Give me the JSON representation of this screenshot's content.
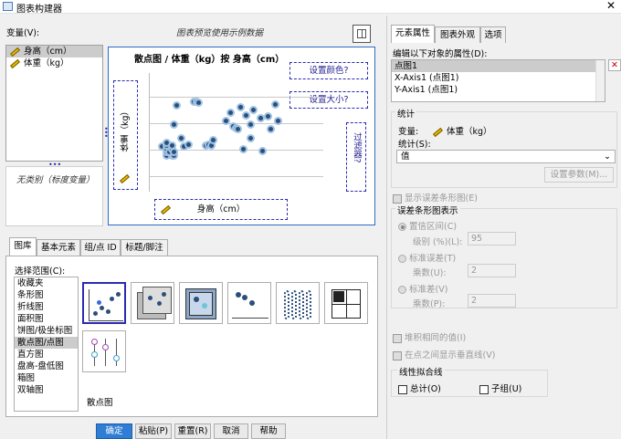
{
  "window": {
    "title": "图表构建器",
    "close_glyph": "✕"
  },
  "variables": {
    "label": "变量(V):",
    "items": [
      "身高（cm）",
      "体重（kg）"
    ],
    "no_category": "无类别（标度变量）"
  },
  "preview": {
    "notice": "图表预览使用示例数据",
    "chart_title": "散点图 / 体重（kg）按 身高（cm）",
    "set_color": "设置颜色?",
    "set_size": "设置大小?",
    "filter": "过滤器?",
    "y_label": "体重（kg）",
    "x_label": "身高（cm）"
  },
  "chart_data": {
    "type": "scatter",
    "title": "散点图 / 体重（kg）按 身高（cm）",
    "xlabel": "身高（cm）",
    "ylabel": "体重（kg）",
    "grid": true,
    "points": [
      [
        1,
        38
      ],
      [
        3,
        30
      ],
      [
        3,
        33
      ],
      [
        3,
        36
      ],
      [
        3,
        39
      ],
      [
        3,
        42
      ],
      [
        5,
        30
      ],
      [
        4,
        33
      ],
      [
        5,
        36
      ],
      [
        5,
        39
      ],
      [
        6,
        30
      ],
      [
        6,
        33
      ],
      [
        6,
        58
      ],
      [
        7,
        76
      ],
      [
        9,
        46
      ],
      [
        10,
        38
      ],
      [
        12,
        40
      ],
      [
        14,
        79
      ],
      [
        15,
        79
      ],
      [
        16,
        78
      ],
      [
        19,
        39
      ],
      [
        20,
        40
      ],
      [
        21,
        39
      ],
      [
        22,
        44
      ],
      [
        27,
        62
      ],
      [
        29,
        69
      ],
      [
        30,
        57
      ],
      [
        31,
        55
      ],
      [
        32,
        54
      ],
      [
        33,
        74
      ],
      [
        34,
        36
      ],
      [
        35,
        67
      ],
      [
        37,
        58
      ],
      [
        37,
        46
      ],
      [
        38,
        72
      ],
      [
        41,
        64
      ],
      [
        42,
        34
      ],
      [
        44,
        66
      ],
      [
        45,
        54
      ],
      [
        47,
        77
      ],
      [
        48,
        62
      ]
    ]
  },
  "bottom_tabs": [
    "图库",
    "基本元素",
    "组/点 ID",
    "标题/脚注"
  ],
  "gallery": {
    "choose_label": "选择范围(C):",
    "categories": [
      "收藏夹",
      "条形图",
      "折线图",
      "面积图",
      "饼图/极坐标图",
      "散点图/点图",
      "直方图",
      "盘高-盘低图",
      "箱图",
      "双轴图"
    ],
    "selected_caption": "散点图"
  },
  "buttons": {
    "ok": "确定",
    "paste": "粘贴(P)",
    "reset": "重置(R)",
    "cancel": "取消",
    "help": "帮助"
  },
  "right_tabs": [
    "元素属性",
    "图表外观",
    "选项"
  ],
  "properties": {
    "edit_label": "编辑以下对象的属性(D):",
    "items": [
      "点图1",
      "X-Axis1 (点图1)",
      "Y-Axis1 (点图1)"
    ],
    "delete_glyph": "✕",
    "stats_title": "统计",
    "variable_label": "变量:",
    "variable_value": "体重（kg）",
    "stat_label": "统计(S):",
    "stat_value": "值",
    "set_params": "设置参数(M)...",
    "show_error_bars": "显示误差条形图(E)",
    "error_bar_title": "误差条形图表示",
    "ci_label": "置信区间(C)",
    "level_label": "级别 (%)(L):",
    "level_value": "95",
    "se_label": "标准误差(T)",
    "multiplier_u": "乘数(U):",
    "multiplier_u_value": "2",
    "sd_label": "标准差(V)",
    "multiplier_p": "乘数(P):",
    "multiplier_p_value": "2",
    "stack_label": "堆积相同的值(I)",
    "drop_lines_label": "在点之间显示垂直线(V)",
    "fit_title": "线性拟合线",
    "total_label": "总计(O)",
    "subgroup_label": "子组(U)"
  }
}
